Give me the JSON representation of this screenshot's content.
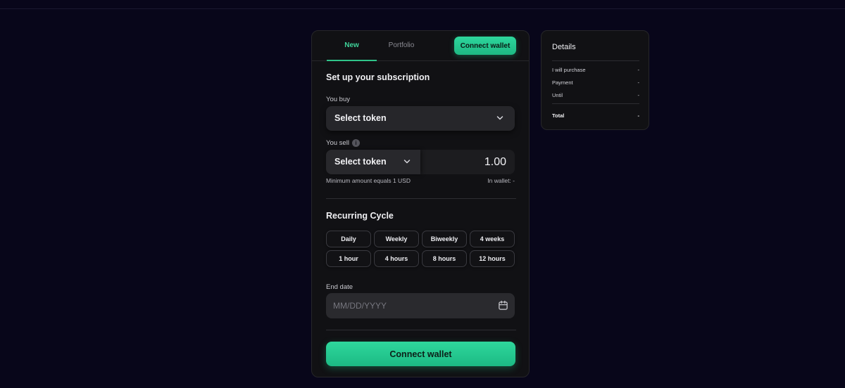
{
  "tabs": {
    "new": "New",
    "portfolio": "Portfolio"
  },
  "header": {
    "connect_wallet": "Connect wallet"
  },
  "form": {
    "title": "Set up your subscription",
    "you_buy_label": "You buy",
    "buy_token": "Select token",
    "you_sell_label": "You sell",
    "sell_token": "Select token",
    "sell_amount": "1.00",
    "min_amount": "Minimum amount equals 1 USD",
    "in_wallet": "In wallet: -"
  },
  "cycle": {
    "title": "Recurring Cycle",
    "options": [
      "Daily",
      "Weekly",
      "Biweekly",
      "4 weeks",
      "1 hour",
      "4 hours",
      "8 hours",
      "12 hours"
    ]
  },
  "end_date": {
    "label": "End date",
    "placeholder": "MM/DD/YYYY"
  },
  "main_button": "Connect wallet",
  "details": {
    "title": "Details",
    "rows": [
      {
        "label": "I will purchase",
        "value": "-"
      },
      {
        "label": "Payment",
        "value": "-"
      },
      {
        "label": "Until",
        "value": "-"
      }
    ],
    "total": {
      "label": "Total",
      "value": "-"
    }
  },
  "colors": {
    "accent": "#2fc489",
    "background": "#08061a",
    "card": "#111114"
  }
}
